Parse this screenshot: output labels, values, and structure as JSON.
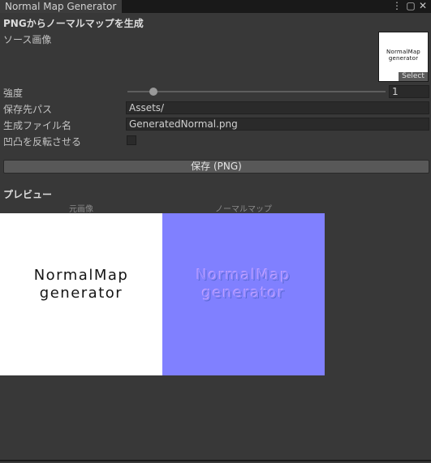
{
  "window": {
    "tab_title": "Normal Map Generator",
    "controls": {
      "menu": "⋮",
      "maximize": "▢",
      "close": "✕"
    }
  },
  "section_title": "PNGからノーマルマップを生成",
  "source": {
    "label": "ソース画像",
    "thumbnail_lines": [
      "NormalMap",
      "generator"
    ],
    "select_label": "Select"
  },
  "strength": {
    "label": "強度",
    "value": "1",
    "level_fraction": 0.1
  },
  "save_path": {
    "label": "保存先パス",
    "value": "Assets/"
  },
  "file_name": {
    "label": "生成ファイル名",
    "value": "GeneratedNormal.png"
  },
  "invert": {
    "label": "凹凸を反転させる",
    "checked": false
  },
  "save_button": "保存 (PNG)",
  "preview": {
    "title": "プレビュー",
    "original_caption": "元画像",
    "normal_caption": "ノーマルマップ",
    "original_lines": [
      "NormalMap",
      "generator"
    ],
    "normal_lines": [
      "NormalMap",
      "generator"
    ],
    "original_bg": "#ffffff",
    "normal_bg": "#8080ff"
  }
}
